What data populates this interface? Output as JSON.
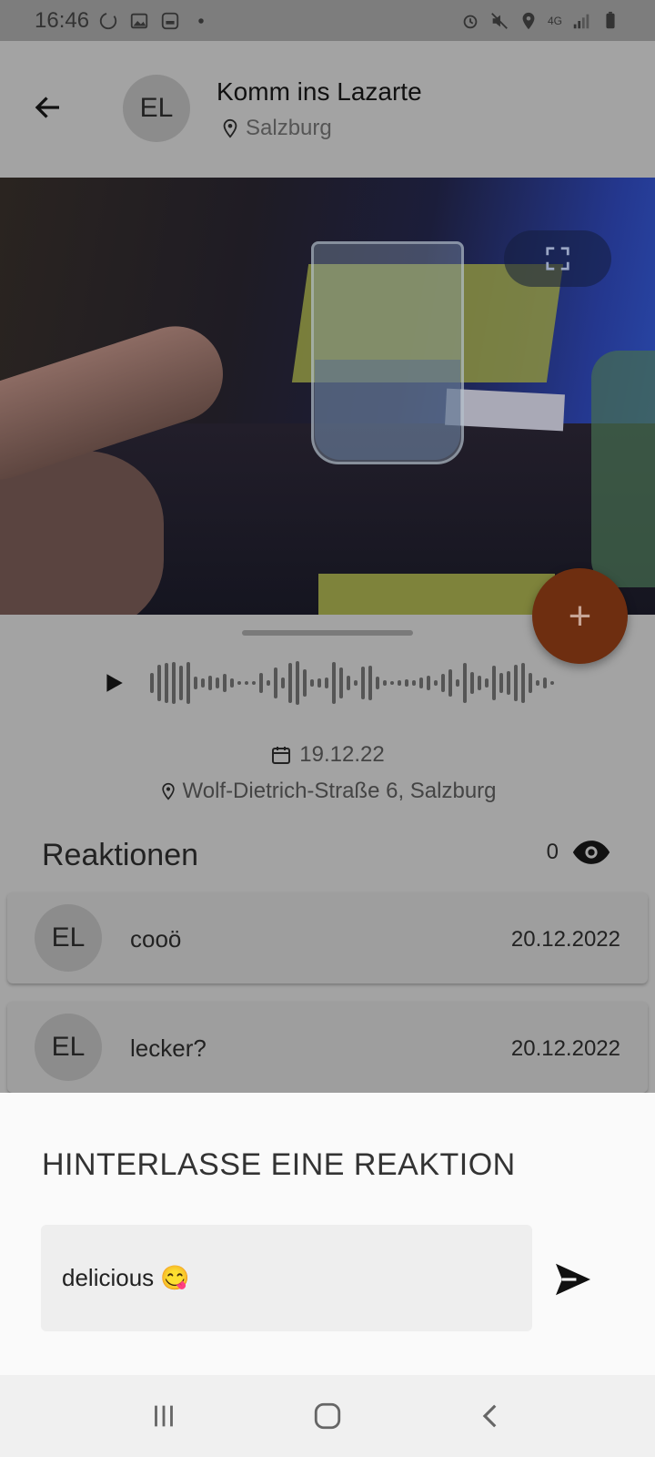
{
  "status_bar": {
    "time": "16:46",
    "network": "4G"
  },
  "header": {
    "avatar_initials": "EL",
    "title": "Komm ins Lazarte",
    "location": "Salzburg",
    "back_icon": "arrow-left-icon"
  },
  "video": {
    "fullscreen_icon": "fullscreen-icon"
  },
  "fab": {
    "label": "+"
  },
  "audio": {
    "play_icon": "play-icon",
    "waveform_bars": [
      22,
      40,
      44,
      46,
      38,
      46,
      14,
      10,
      16,
      12,
      20,
      10,
      4,
      4,
      4,
      22,
      6,
      34,
      12,
      44,
      48,
      30,
      8,
      10,
      12,
      46,
      34,
      16,
      6,
      36,
      38,
      14,
      6,
      4,
      6,
      8,
      6,
      12,
      16,
      6,
      20,
      30,
      8,
      44,
      24,
      16,
      10,
      38,
      22,
      26,
      40,
      44,
      22,
      6,
      12,
      4
    ]
  },
  "meta": {
    "date": "19.12.22",
    "address": "Wolf-Dietrich-Straße 6, Salzburg"
  },
  "reactions": {
    "title": "Reaktionen",
    "view_count": "0",
    "items": [
      {
        "initials": "EL",
        "text": "cooö",
        "date": "20.12.2022"
      },
      {
        "initials": "EL",
        "text": "lecker?",
        "date": "20.12.2022"
      }
    ]
  },
  "compose": {
    "title": "HINTERLASSE EINE REAKTION",
    "value": "delicious 😋",
    "send_icon": "send-icon"
  },
  "nav": {
    "recents_icon": "recents-icon",
    "home_icon": "home-icon",
    "back_icon": "nav-back-icon"
  },
  "colors": {
    "fab": "#6e2e10",
    "scrim": "#a3a3a3",
    "sheet": "#fafafa"
  }
}
